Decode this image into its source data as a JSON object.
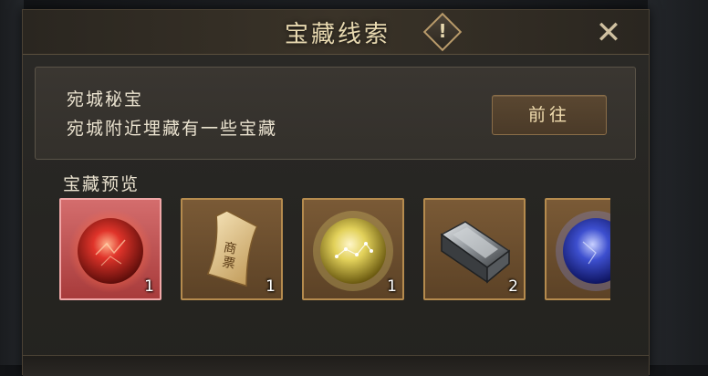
{
  "dialog": {
    "title": "宝藏线索",
    "info_mark": "!",
    "close_glyph": "✕"
  },
  "quest": {
    "name": "宛城秘宝",
    "description": "宛城附近埋藏有一些宝藏",
    "go_button_label": "前往"
  },
  "preview": {
    "label": "宝藏预览",
    "items": [
      {
        "icon": "red-orb-icon",
        "count": "1",
        "rarity": "rare",
        "color": "#e0342a"
      },
      {
        "icon": "banknote-scroll-icon",
        "count": "1",
        "rarity": "normal",
        "text": "商票",
        "color": "#d9b779"
      },
      {
        "icon": "gold-orb-icon",
        "count": "1",
        "rarity": "normal",
        "color": "#e2d15a"
      },
      {
        "icon": "silver-ingot-icon",
        "count": "2",
        "rarity": "normal",
        "color": "#a9adb1"
      },
      {
        "icon": "blue-orb-icon",
        "count": "",
        "rarity": "normal",
        "color": "#3d4fcf"
      }
    ]
  }
}
